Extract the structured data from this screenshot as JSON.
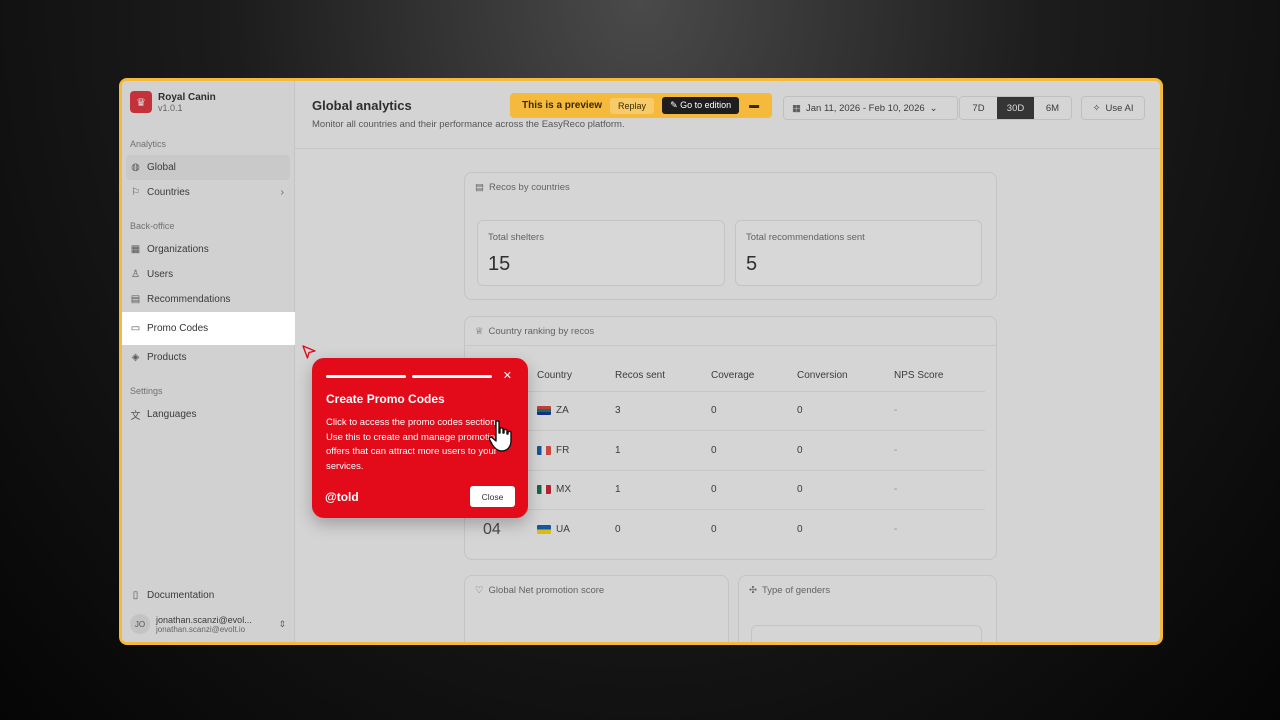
{
  "sidebar": {
    "brand_name": "Royal Canin",
    "brand_version": "v1.0.1",
    "sections": [
      {
        "label": "Analytics"
      },
      {
        "label": "Back-office"
      },
      {
        "label": "Settings"
      }
    ],
    "items": {
      "global": "Global",
      "countries": "Countries",
      "organizations": "Organizations",
      "users": "Users",
      "recommendations": "Recommendations",
      "promo_codes": "Promo Codes",
      "products": "Products",
      "languages": "Languages",
      "documentation": "Documentation"
    },
    "user": {
      "initials": "JO",
      "name": "jonathan.scanzi@evol...",
      "email": "jonathan.scanzi@evolt.io"
    }
  },
  "header": {
    "title": "Global analytics",
    "subtitle": "Monitor all countries and their performance across the EasyReco platform.",
    "preview": {
      "label": "This is a preview",
      "replay": "Replay",
      "go_to_edition": "Go to edition"
    },
    "date_range": "Jan 11, 2026 - Feb 10, 2026",
    "ranges": [
      "7D",
      "30D",
      "6M"
    ],
    "selected_range": "30D",
    "use_ai": "Use AI"
  },
  "recos_card": {
    "title": "Recos by countries",
    "total_shelters_label": "Total shelters",
    "total_shelters_value": "15",
    "total_recos_label": "Total recommendations sent",
    "total_recos_value": "5"
  },
  "ranking_card": {
    "title": "Country ranking by recos",
    "columns": [
      "Country",
      "Recos sent",
      "Coverage",
      "Conversion",
      "NPS Score"
    ],
    "rows": [
      {
        "rank": "",
        "country": "ZA",
        "recos": "3",
        "coverage": "0",
        "conversion": "0",
        "nps": "-"
      },
      {
        "rank": "",
        "country": "FR",
        "recos": "1",
        "coverage": "0",
        "conversion": "0",
        "nps": "-"
      },
      {
        "rank": "",
        "country": "MX",
        "recos": "1",
        "coverage": "0",
        "conversion": "0",
        "nps": "-"
      },
      {
        "rank": "04",
        "country": "UA",
        "recos": "0",
        "coverage": "0",
        "conversion": "0",
        "nps": "-"
      }
    ]
  },
  "nps_card": {
    "title": "Global Net promotion score"
  },
  "genders_card": {
    "title": "Type of genders"
  },
  "popup": {
    "title": "Create Promo Codes",
    "body": "Click to access the promo codes section. Use this to create and manage promotional offers that can attract more users to your services.",
    "brand": "@told",
    "close_label": "Close"
  },
  "colors": {
    "frame_border": "#f5b93c",
    "popup_red": "#e30b1a",
    "preview_yellow": "#f5b93c"
  }
}
